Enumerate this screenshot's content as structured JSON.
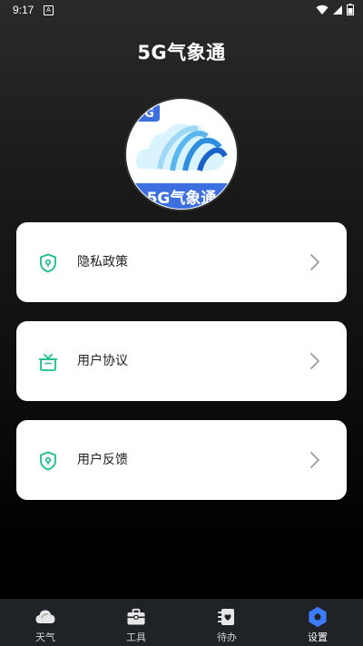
{
  "status_bar": {
    "time": "9:17",
    "notification_letter": "A",
    "icons": [
      "wifi-icon",
      "signal-icon",
      "battery-icon"
    ]
  },
  "header": {
    "title": "5G气象通"
  },
  "logo": {
    "text": "5G气象通",
    "badge": "5G",
    "accent_color": "#3d6fe0"
  },
  "menu": {
    "items": [
      {
        "label": "隐私政策",
        "icon": "shield-lock-icon"
      },
      {
        "label": "用户协议",
        "icon": "gift-box-icon"
      },
      {
        "label": "用户反馈",
        "icon": "shield-lock-icon"
      }
    ],
    "icon_color": "#1bbf8a"
  },
  "bottom_nav": {
    "items": [
      {
        "label": "天气",
        "icon": "cloud-icon"
      },
      {
        "label": "工具",
        "icon": "toolbox-icon"
      },
      {
        "label": "待办",
        "icon": "todo-icon"
      },
      {
        "label": "设置",
        "icon": "settings-icon"
      }
    ],
    "active_index": 3,
    "active_color": "#3d7bff"
  }
}
